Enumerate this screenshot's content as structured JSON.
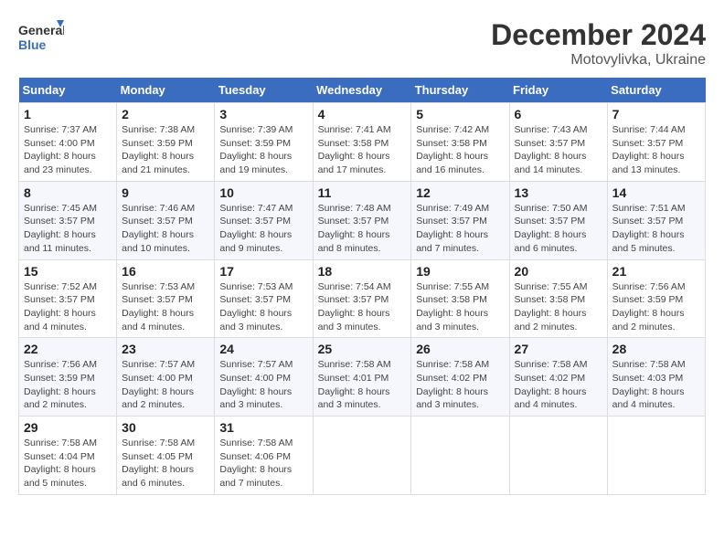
{
  "header": {
    "logo_line1": "General",
    "logo_line2": "Blue",
    "month": "December 2024",
    "location": "Motovylivka, Ukraine"
  },
  "weekdays": [
    "Sunday",
    "Monday",
    "Tuesday",
    "Wednesday",
    "Thursday",
    "Friday",
    "Saturday"
  ],
  "weeks": [
    [
      {
        "day": "1",
        "info": "Sunrise: 7:37 AM\nSunset: 4:00 PM\nDaylight: 8 hours\nand 23 minutes."
      },
      {
        "day": "2",
        "info": "Sunrise: 7:38 AM\nSunset: 3:59 PM\nDaylight: 8 hours\nand 21 minutes."
      },
      {
        "day": "3",
        "info": "Sunrise: 7:39 AM\nSunset: 3:59 PM\nDaylight: 8 hours\nand 19 minutes."
      },
      {
        "day": "4",
        "info": "Sunrise: 7:41 AM\nSunset: 3:58 PM\nDaylight: 8 hours\nand 17 minutes."
      },
      {
        "day": "5",
        "info": "Sunrise: 7:42 AM\nSunset: 3:58 PM\nDaylight: 8 hours\nand 16 minutes."
      },
      {
        "day": "6",
        "info": "Sunrise: 7:43 AM\nSunset: 3:57 PM\nDaylight: 8 hours\nand 14 minutes."
      },
      {
        "day": "7",
        "info": "Sunrise: 7:44 AM\nSunset: 3:57 PM\nDaylight: 8 hours\nand 13 minutes."
      }
    ],
    [
      {
        "day": "8",
        "info": "Sunrise: 7:45 AM\nSunset: 3:57 PM\nDaylight: 8 hours\nand 11 minutes."
      },
      {
        "day": "9",
        "info": "Sunrise: 7:46 AM\nSunset: 3:57 PM\nDaylight: 8 hours\nand 10 minutes."
      },
      {
        "day": "10",
        "info": "Sunrise: 7:47 AM\nSunset: 3:57 PM\nDaylight: 8 hours\nand 9 minutes."
      },
      {
        "day": "11",
        "info": "Sunrise: 7:48 AM\nSunset: 3:57 PM\nDaylight: 8 hours\nand 8 minutes."
      },
      {
        "day": "12",
        "info": "Sunrise: 7:49 AM\nSunset: 3:57 PM\nDaylight: 8 hours\nand 7 minutes."
      },
      {
        "day": "13",
        "info": "Sunrise: 7:50 AM\nSunset: 3:57 PM\nDaylight: 8 hours\nand 6 minutes."
      },
      {
        "day": "14",
        "info": "Sunrise: 7:51 AM\nSunset: 3:57 PM\nDaylight: 8 hours\nand 5 minutes."
      }
    ],
    [
      {
        "day": "15",
        "info": "Sunrise: 7:52 AM\nSunset: 3:57 PM\nDaylight: 8 hours\nand 4 minutes."
      },
      {
        "day": "16",
        "info": "Sunrise: 7:53 AM\nSunset: 3:57 PM\nDaylight: 8 hours\nand 4 minutes."
      },
      {
        "day": "17",
        "info": "Sunrise: 7:53 AM\nSunset: 3:57 PM\nDaylight: 8 hours\nand 3 minutes."
      },
      {
        "day": "18",
        "info": "Sunrise: 7:54 AM\nSunset: 3:57 PM\nDaylight: 8 hours\nand 3 minutes."
      },
      {
        "day": "19",
        "info": "Sunrise: 7:55 AM\nSunset: 3:58 PM\nDaylight: 8 hours\nand 3 minutes."
      },
      {
        "day": "20",
        "info": "Sunrise: 7:55 AM\nSunset: 3:58 PM\nDaylight: 8 hours\nand 2 minutes."
      },
      {
        "day": "21",
        "info": "Sunrise: 7:56 AM\nSunset: 3:59 PM\nDaylight: 8 hours\nand 2 minutes."
      }
    ],
    [
      {
        "day": "22",
        "info": "Sunrise: 7:56 AM\nSunset: 3:59 PM\nDaylight: 8 hours\nand 2 minutes."
      },
      {
        "day": "23",
        "info": "Sunrise: 7:57 AM\nSunset: 4:00 PM\nDaylight: 8 hours\nand 2 minutes."
      },
      {
        "day": "24",
        "info": "Sunrise: 7:57 AM\nSunset: 4:00 PM\nDaylight: 8 hours\nand 3 minutes."
      },
      {
        "day": "25",
        "info": "Sunrise: 7:58 AM\nSunset: 4:01 PM\nDaylight: 8 hours\nand 3 minutes."
      },
      {
        "day": "26",
        "info": "Sunrise: 7:58 AM\nSunset: 4:02 PM\nDaylight: 8 hours\nand 3 minutes."
      },
      {
        "day": "27",
        "info": "Sunrise: 7:58 AM\nSunset: 4:02 PM\nDaylight: 8 hours\nand 4 minutes."
      },
      {
        "day": "28",
        "info": "Sunrise: 7:58 AM\nSunset: 4:03 PM\nDaylight: 8 hours\nand 4 minutes."
      }
    ],
    [
      {
        "day": "29",
        "info": "Sunrise: 7:58 AM\nSunset: 4:04 PM\nDaylight: 8 hours\nand 5 minutes."
      },
      {
        "day": "30",
        "info": "Sunrise: 7:58 AM\nSunset: 4:05 PM\nDaylight: 8 hours\nand 6 minutes."
      },
      {
        "day": "31",
        "info": "Sunrise: 7:58 AM\nSunset: 4:06 PM\nDaylight: 8 hours\nand 7 minutes."
      },
      null,
      null,
      null,
      null
    ]
  ]
}
